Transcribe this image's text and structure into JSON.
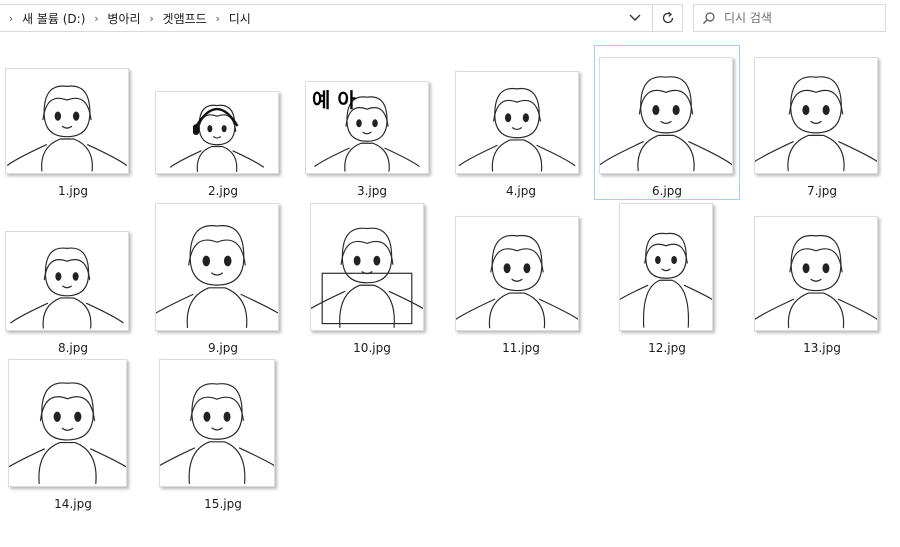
{
  "address_bar": {
    "breadcrumbs": [
      "새 볼륨 (D:)",
      "병아리",
      "겟앰프드",
      "디시"
    ]
  },
  "search": {
    "placeholder": "디시 검색"
  },
  "files": [
    {
      "name": "1.jpg",
      "selected": false,
      "caption": ""
    },
    {
      "name": "2.jpg",
      "selected": false,
      "caption": ""
    },
    {
      "name": "3.jpg",
      "selected": false,
      "caption": "예 아"
    },
    {
      "name": "4.jpg",
      "selected": false,
      "caption": ""
    },
    {
      "name": "6.jpg",
      "selected": true,
      "caption": ""
    },
    {
      "name": "7.jpg",
      "selected": false,
      "caption": ""
    },
    {
      "name": "8.jpg",
      "selected": false,
      "caption": ""
    },
    {
      "name": "9.jpg",
      "selected": false,
      "caption": ""
    },
    {
      "name": "10.jpg",
      "selected": false,
      "caption": ""
    },
    {
      "name": "11.jpg",
      "selected": false,
      "caption": ""
    },
    {
      "name": "12.jpg",
      "selected": false,
      "caption": ""
    },
    {
      "name": "13.jpg",
      "selected": false,
      "caption": ""
    },
    {
      "name": "14.jpg",
      "selected": false,
      "caption": ""
    },
    {
      "name": "15.jpg",
      "selected": false,
      "caption": ""
    }
  ]
}
